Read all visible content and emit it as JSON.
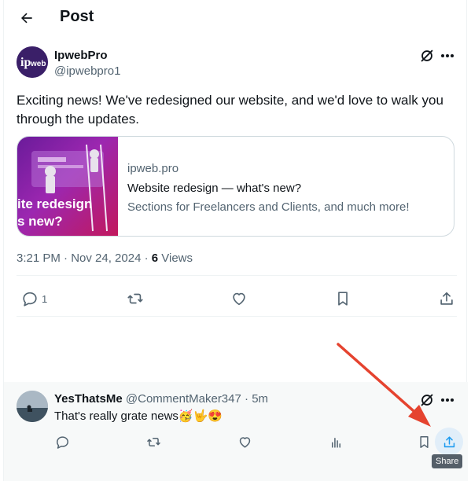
{
  "header": {
    "title": "Post",
    "back_icon": "arrow-left-icon"
  },
  "post": {
    "author_name": "IpwebPro",
    "author_handle": "@ipwebpro1",
    "avatar_text": "ip web",
    "text": "Exciting news! We've redesigned our website, and we'd love to walk you through the updates.",
    "card": {
      "thumb_line1": "ite redesign",
      "thumb_line2": "s new?",
      "domain": "ipweb.pro",
      "title": "Website redesign — what's new?",
      "description": "Sections for Freelancers and Clients, and much more!"
    },
    "timestamp": "3:21 PM · Nov 24, 2024 · ",
    "views_count": "6",
    "views_label": " Views",
    "actions": {
      "reply_count": "1"
    }
  },
  "reply": {
    "author_name": "YesThatsMe",
    "author_handle": "@CommentMaker347",
    "separator": " · ",
    "time": "5m",
    "text": "That's really grate news🥳🤟😍"
  },
  "tooltip": {
    "share": "Share"
  },
  "colors": {
    "accent": "#1d9bf0",
    "muted": "#536471",
    "annotation": "#e5432f"
  }
}
